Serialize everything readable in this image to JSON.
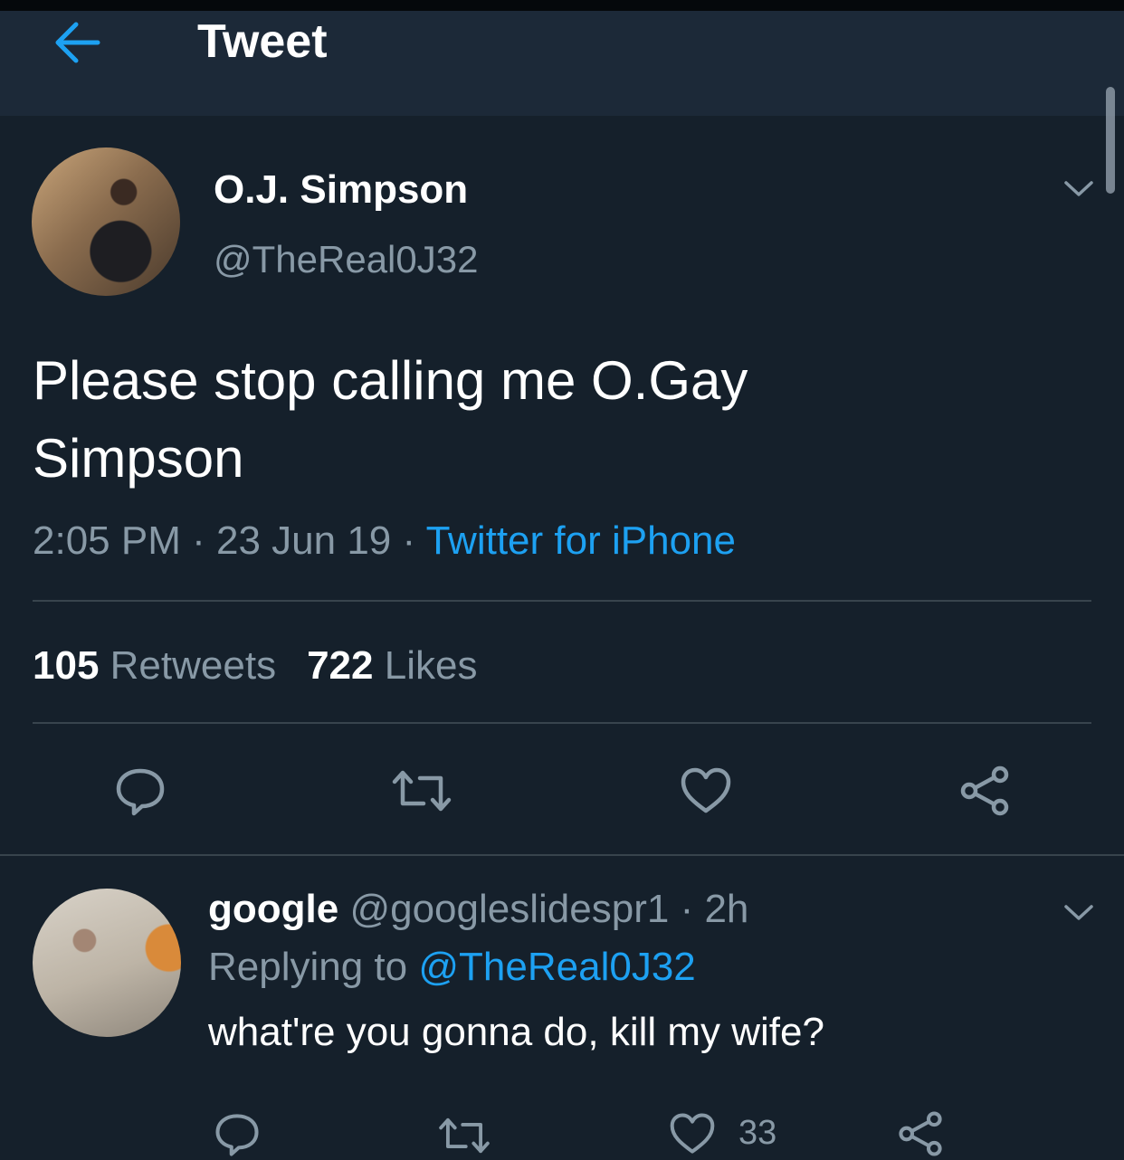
{
  "header": {
    "title": "Tweet"
  },
  "tweet": {
    "author_name": "O.J. Simpson",
    "author_handle": "@TheReal0J32",
    "text": "Please stop calling me O.Gay Simpson",
    "time": "2:05 PM",
    "date": "23 Jun 19",
    "source": "Twitter for iPhone",
    "retweets_count": "105",
    "retweets_label": "Retweets",
    "likes_count": "722",
    "likes_label": "Likes"
  },
  "reply": {
    "author_name": "google",
    "author_handle": "@googleslidespr1",
    "age": "2h",
    "replying_prefix": "Replying to",
    "replying_handle": "@TheReal0J32",
    "text": "what're you gonna do, kill my wife?",
    "like_count": "33"
  },
  "icons": {
    "back": "arrow-left-icon",
    "menu": "chevron-down-icon",
    "reply": "comment-icon",
    "retweet": "retweet-icon",
    "like": "heart-icon",
    "share": "share-icon"
  },
  "colors": {
    "background": "#15202b",
    "header": "#1c2938",
    "accent": "#1da1f2",
    "secondary_text": "#8899a6",
    "divider": "#38444d"
  }
}
